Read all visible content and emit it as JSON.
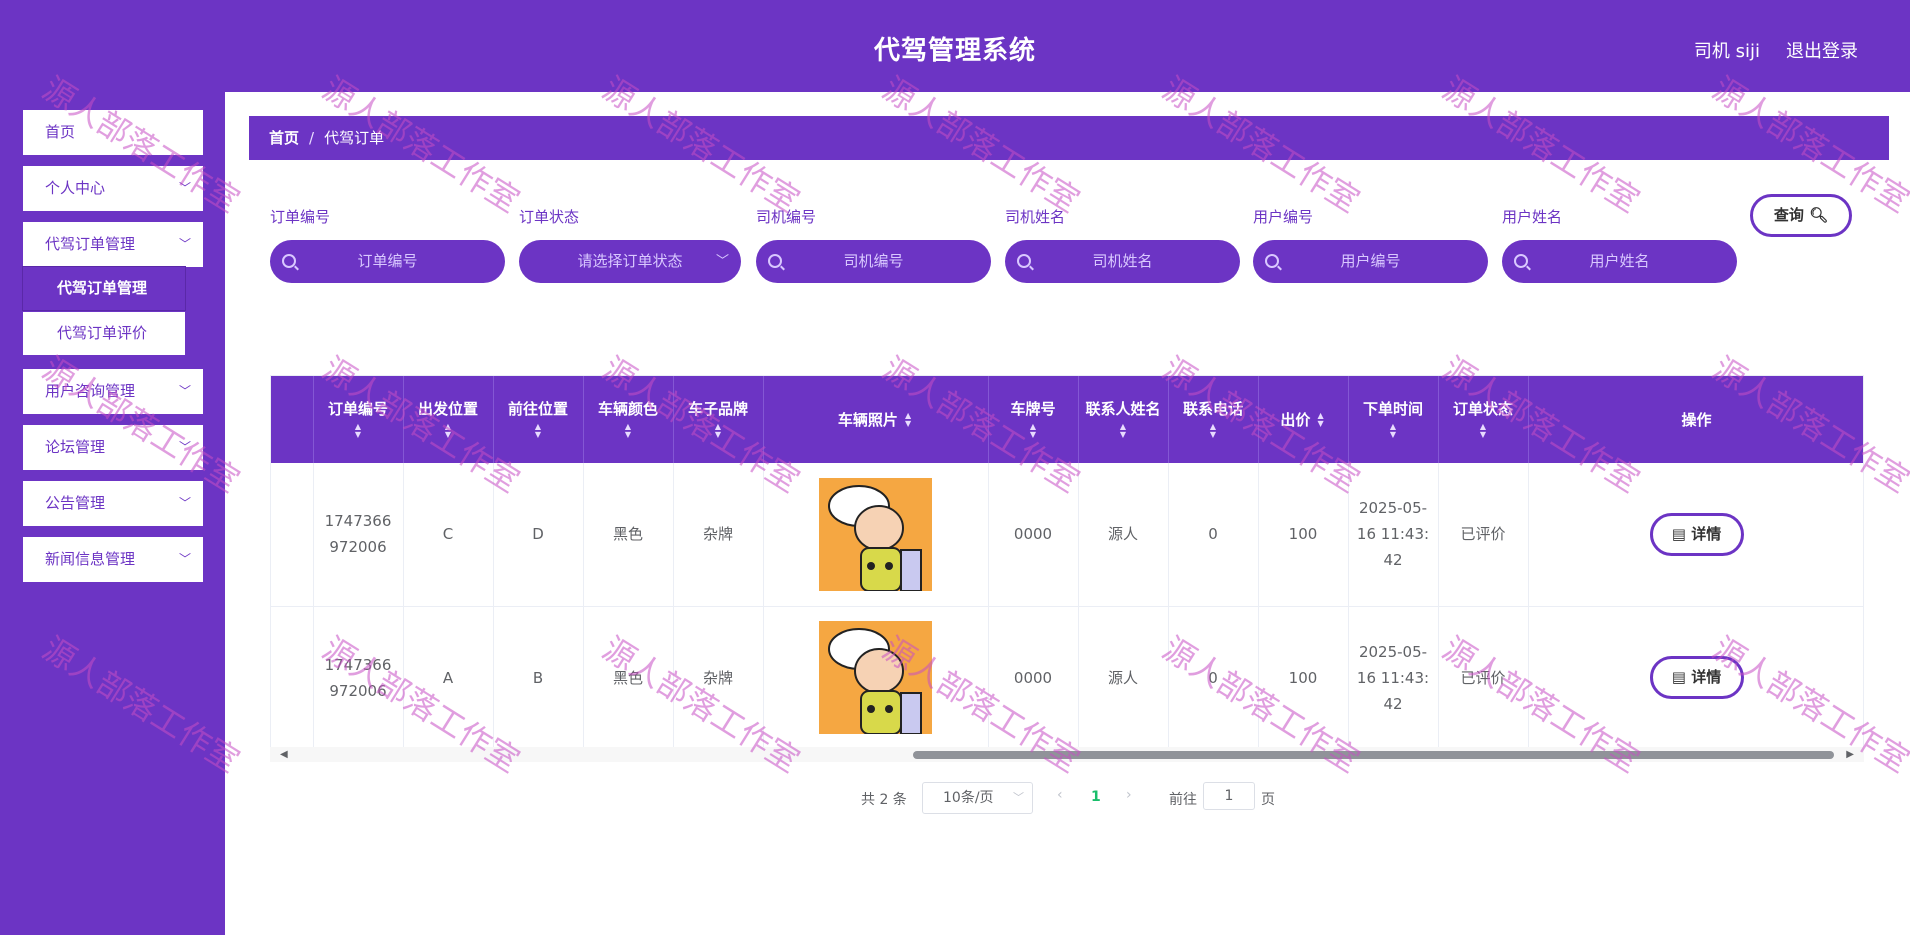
{
  "header": {
    "title": "代驾管理系统",
    "user": "司机 siji",
    "logout": "退出登录"
  },
  "sidebar": {
    "items": [
      {
        "label": "首页"
      },
      {
        "label": "个人中心"
      },
      {
        "label": "代驾订单管理"
      },
      {
        "label": "用户咨询管理"
      },
      {
        "label": "论坛管理"
      },
      {
        "label": "公告管理"
      },
      {
        "label": "新闻信息管理"
      }
    ],
    "submenu": [
      {
        "label": "代驾订单管理"
      },
      {
        "label": "代驾订单评价"
      }
    ]
  },
  "breadcrumb": {
    "home": "首页",
    "sep": "/",
    "current": "代驾订单"
  },
  "filters": {
    "order_no": {
      "label": "订单编号",
      "placeholder": "订单编号"
    },
    "order_status": {
      "label": "订单状态",
      "placeholder": "请选择订单状态"
    },
    "driver_no": {
      "label": "司机编号",
      "placeholder": "司机编号"
    },
    "driver_name": {
      "label": "司机姓名",
      "placeholder": "司机姓名"
    },
    "user_no": {
      "label": "用户编号",
      "placeholder": "用户编号"
    },
    "user_name": {
      "label": "用户姓名",
      "placeholder": "用户姓名"
    },
    "query_label": "查询"
  },
  "table": {
    "headers": [
      "订单编号",
      "出发位置",
      "前往位置",
      "车辆颜色",
      "车子品牌",
      "车辆照片",
      "车牌号",
      "联系人姓名",
      "联系电话",
      "出价",
      "下单时间",
      "订单状态",
      "操作"
    ],
    "rows": [
      {
        "order_no": "1747366972006",
        "from": "C",
        "to": "D",
        "color": "黑色",
        "brand": "杂牌",
        "plate": "0000",
        "contact": "源人",
        "phone": "0",
        "price": "100",
        "time": "2025-05-16 11:43:42",
        "status": "已评价",
        "action": "详情"
      },
      {
        "order_no": "1747366972006",
        "from": "A",
        "to": "B",
        "color": "黑色",
        "brand": "杂牌",
        "plate": "0000",
        "contact": "源人",
        "phone": "0",
        "price": "100",
        "time": "2025-05-16 11:43:42",
        "status": "已评价",
        "action": "详情"
      }
    ]
  },
  "pagination": {
    "total": "共 2 条",
    "page_size": "10条/页",
    "current": "1",
    "goto": "前往",
    "goto_value": "1",
    "unit": "页"
  },
  "watermark": "源人部落工作室",
  "colors": {
    "primary": "#6c34c4",
    "accent": "#19be6b",
    "watermark": "#c74ec4"
  }
}
